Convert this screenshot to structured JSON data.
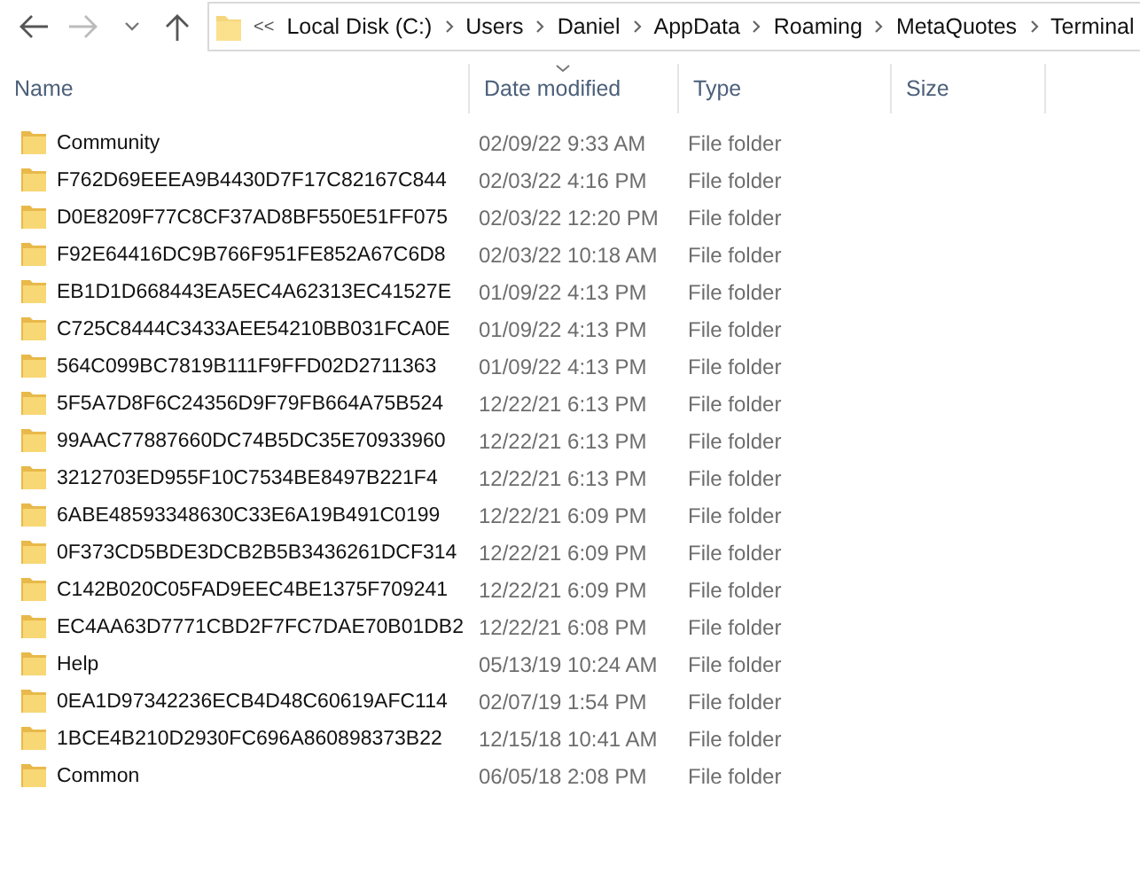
{
  "address_bar": {
    "overflow": "<<",
    "path": [
      "Local Disk (C:)",
      "Users",
      "Daniel",
      "AppData",
      "Roaming",
      "MetaQuotes",
      "Terminal"
    ]
  },
  "columns": [
    {
      "label": "Name",
      "sorted": false
    },
    {
      "label": "Date modified",
      "sorted": true
    },
    {
      "label": "Type",
      "sorted": false
    },
    {
      "label": "Size",
      "sorted": false
    }
  ],
  "rows": [
    {
      "name": "Community",
      "date": "02/09/22 9:33 AM",
      "type": "File folder"
    },
    {
      "name": "F762D69EEEA9B4430D7F17C82167C844",
      "date": "02/03/22 4:16 PM",
      "type": "File folder"
    },
    {
      "name": "D0E8209F77C8CF37AD8BF550E51FF075",
      "date": "02/03/22 12:20 PM",
      "type": "File folder"
    },
    {
      "name": "F92E64416DC9B766F951FE852A67C6D8",
      "date": "02/03/22 10:18 AM",
      "type": "File folder"
    },
    {
      "name": "EB1D1D668443EA5EC4A62313EC41527E",
      "date": "01/09/22 4:13 PM",
      "type": "File folder"
    },
    {
      "name": "C725C8444C3433AEE54210BB031FCA0E",
      "date": "01/09/22 4:13 PM",
      "type": "File folder"
    },
    {
      "name": "564C099BC7819B111F9FFD02D2711363",
      "date": "01/09/22 4:13 PM",
      "type": "File folder"
    },
    {
      "name": "5F5A7D8F6C24356D9F79FB664A75B524",
      "date": "12/22/21 6:13 PM",
      "type": "File folder"
    },
    {
      "name": "99AAC77887660DC74B5DC35E70933960",
      "date": "12/22/21 6:13 PM",
      "type": "File folder"
    },
    {
      "name": "3212703ED955F10C7534BE8497B221F4",
      "date": "12/22/21 6:13 PM",
      "type": "File folder"
    },
    {
      "name": "6ABE48593348630C33E6A19B491C0199",
      "date": "12/22/21 6:09 PM",
      "type": "File folder"
    },
    {
      "name": "0F373CD5BDE3DCB2B5B3436261DCF314",
      "date": "12/22/21 6:09 PM",
      "type": "File folder"
    },
    {
      "name": "C142B020C05FAD9EEC4BE1375F709241",
      "date": "12/22/21 6:09 PM",
      "type": "File folder"
    },
    {
      "name": "EC4AA63D7771CBD2F7FC7DAE70B01DB2",
      "date": "12/22/21 6:08 PM",
      "type": "File folder"
    },
    {
      "name": "Help",
      "date": "05/13/19 10:24 AM",
      "type": "File folder"
    },
    {
      "name": "0EA1D97342236ECB4D48C60619AFC114",
      "date": "02/07/19 1:54 PM",
      "type": "File folder"
    },
    {
      "name": "1BCE4B210D2930FC696A860898373B22",
      "date": "12/15/18 10:41 AM",
      "type": "File folder"
    },
    {
      "name": "Common",
      "date": "06/05/18 2:08 PM",
      "type": "File folder"
    }
  ]
}
